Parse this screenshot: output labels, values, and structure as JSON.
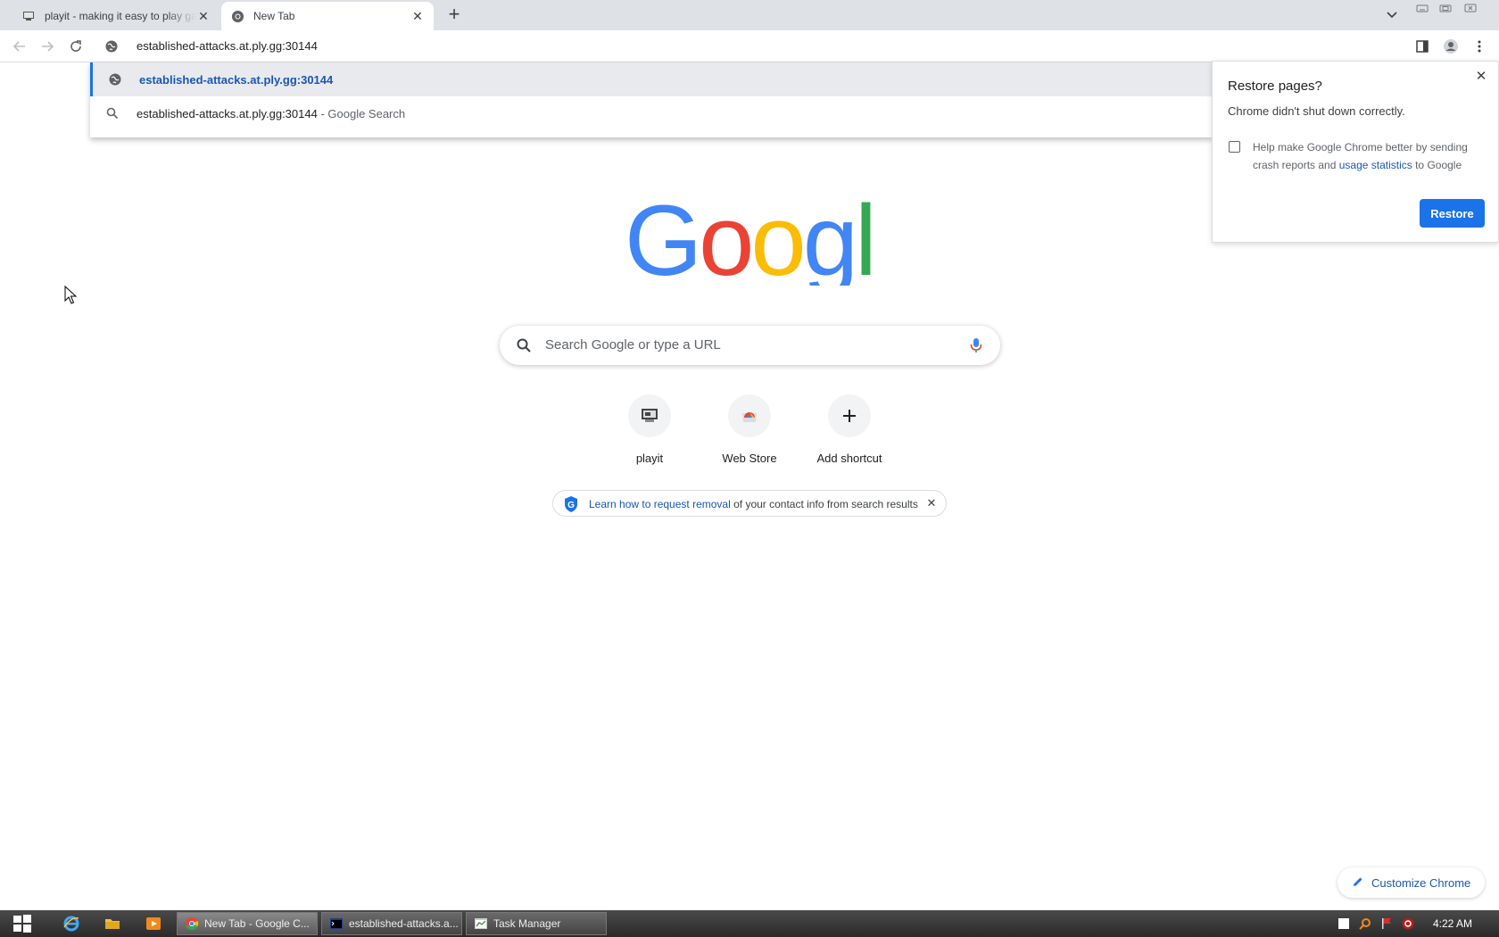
{
  "browser": {
    "tabs": [
      {
        "title": "playit - making it easy to play games",
        "icon": "playit-favicon",
        "active": false
      },
      {
        "title": "New Tab",
        "icon": "chrome-favicon",
        "active": true
      }
    ],
    "address_bar": {
      "value": "established-attacks.at.ply.gg:30144"
    }
  },
  "omnibox_dropdown": {
    "suggestions": [
      {
        "text": "established-attacks.at.ply.gg:30144",
        "suffix": "",
        "icon": "globe-icon"
      },
      {
        "text": "established-attacks.at.ply.gg:30144",
        "suffix": " - Google Search",
        "icon": "search-icon"
      }
    ]
  },
  "restore_bubble": {
    "title": "Restore pages?",
    "message": "Chrome didn't shut down correctly.",
    "help_text_before": "Help make Google Chrome better by sending crash reports and ",
    "help_link": "usage statistics",
    "help_text_after": " to Google",
    "button": "Restore",
    "checkbox_checked": false
  },
  "ntp": {
    "logo_text": "Google",
    "search_placeholder": "Search Google or type a URL",
    "shortcuts": [
      {
        "label": "playit",
        "icon": "playit-icon"
      },
      {
        "label": "Web Store",
        "icon": "web-store-icon"
      },
      {
        "label": "Add shortcut",
        "icon": "plus-icon"
      }
    ],
    "promo": {
      "link_text": "Learn how to request removal",
      "rest_text": " of your contact info from search results"
    },
    "customize_label": "Customize Chrome"
  },
  "taskbar": {
    "tasks": [
      {
        "label": "New Tab - Google C...",
        "icon": "chrome-icon",
        "active": true
      },
      {
        "label": "established-attacks.a...",
        "icon": "console-icon",
        "active": false
      },
      {
        "label": "Task Manager",
        "icon": "task-manager-icon",
        "active": false
      }
    ],
    "clock": "4:22 AM"
  },
  "colors": {
    "accent": "#1a73e8",
    "link": "#1a57b0",
    "google_blue": "#4285f4",
    "google_red": "#ea4335",
    "google_yellow": "#fbbc05",
    "google_green": "#34a853"
  }
}
